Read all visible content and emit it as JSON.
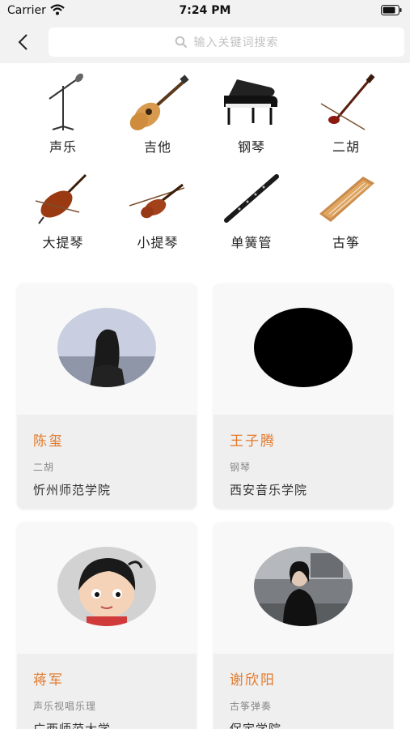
{
  "status_bar": {
    "carrier": "Carrier",
    "time": "7:24 PM"
  },
  "header": {
    "search_placeholder": "输入关键词搜索"
  },
  "categories": [
    {
      "label": "声乐",
      "icon": "microphone-stand-icon"
    },
    {
      "label": "吉他",
      "icon": "guitar-icon"
    },
    {
      "label": "钢琴",
      "icon": "grand-piano-icon"
    },
    {
      "label": "二胡",
      "icon": "erhu-icon"
    },
    {
      "label": "大提琴",
      "icon": "cello-icon"
    },
    {
      "label": "小提琴",
      "icon": "violin-icon"
    },
    {
      "label": "单簧管",
      "icon": "clarinet-icon"
    },
    {
      "label": "古筝",
      "icon": "guzheng-icon"
    }
  ],
  "teachers": [
    {
      "name": "陈玺",
      "subject": "二胡",
      "school": "忻州师范学院",
      "avatar": "photo"
    },
    {
      "name": "王子腾",
      "subject": "钢琴",
      "school": "西安音乐学院",
      "avatar": "black"
    },
    {
      "name": "蒋军",
      "subject": "声乐视唱乐理",
      "school": "广西师范大学",
      "avatar": "cartoon"
    },
    {
      "name": "谢欣阳",
      "subject": "古筝弹奏",
      "school": "保定学院",
      "avatar": "photo"
    }
  ],
  "colors": {
    "accent": "#e27a2c",
    "background": "#f2f2f2"
  }
}
